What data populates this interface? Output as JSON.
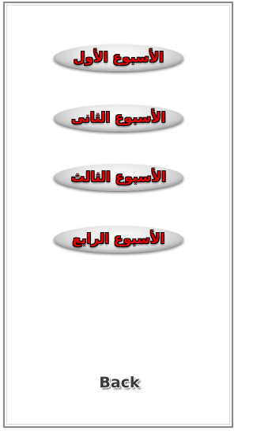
{
  "weeks": [
    {
      "label": "الأسبوع الأول"
    },
    {
      "label": "الأسبوع الثانى"
    },
    {
      "label": "الأسبوع الثالث"
    },
    {
      "label": "الأسبوع الرابع"
    }
  ],
  "footer": {
    "back_label": "Back"
  },
  "colors": {
    "label_text": "#e00000",
    "button_face": "#e6e6e6",
    "back_text": "#3a3a3a"
  }
}
